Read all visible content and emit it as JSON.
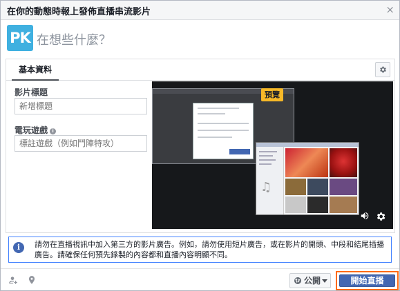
{
  "dialog": {
    "title": "在你的動態時報上發佈直播串流影片",
    "close_glyph": "×"
  },
  "composer": {
    "logo_text": "PK",
    "placeholder": "在想些什麼？"
  },
  "tabs": {
    "basic_label": "基本資料"
  },
  "form": {
    "video_title_label": "影片標題",
    "video_title_placeholder": "新增標題",
    "game_label": "電玩遊戲",
    "game_placeholder": "標註遊戲（例如鬥陣特攻）"
  },
  "preview": {
    "badge": "預覽"
  },
  "notice": {
    "text": "請勿在直播視訊中加入第三方的影片廣告。例如，請勿使用短片廣告，或在影片的開頭、中段和結尾插播廣告。請確保任何預先錄製的內容都和直播內容明顯不同。"
  },
  "footer": {
    "privacy_label": "公開",
    "go_live_label": "開始直播"
  },
  "colors": {
    "primary": "#4267b2",
    "highlight": "#ff6a13",
    "badge": "#f7b928",
    "notice_border": "#4080ff"
  }
}
